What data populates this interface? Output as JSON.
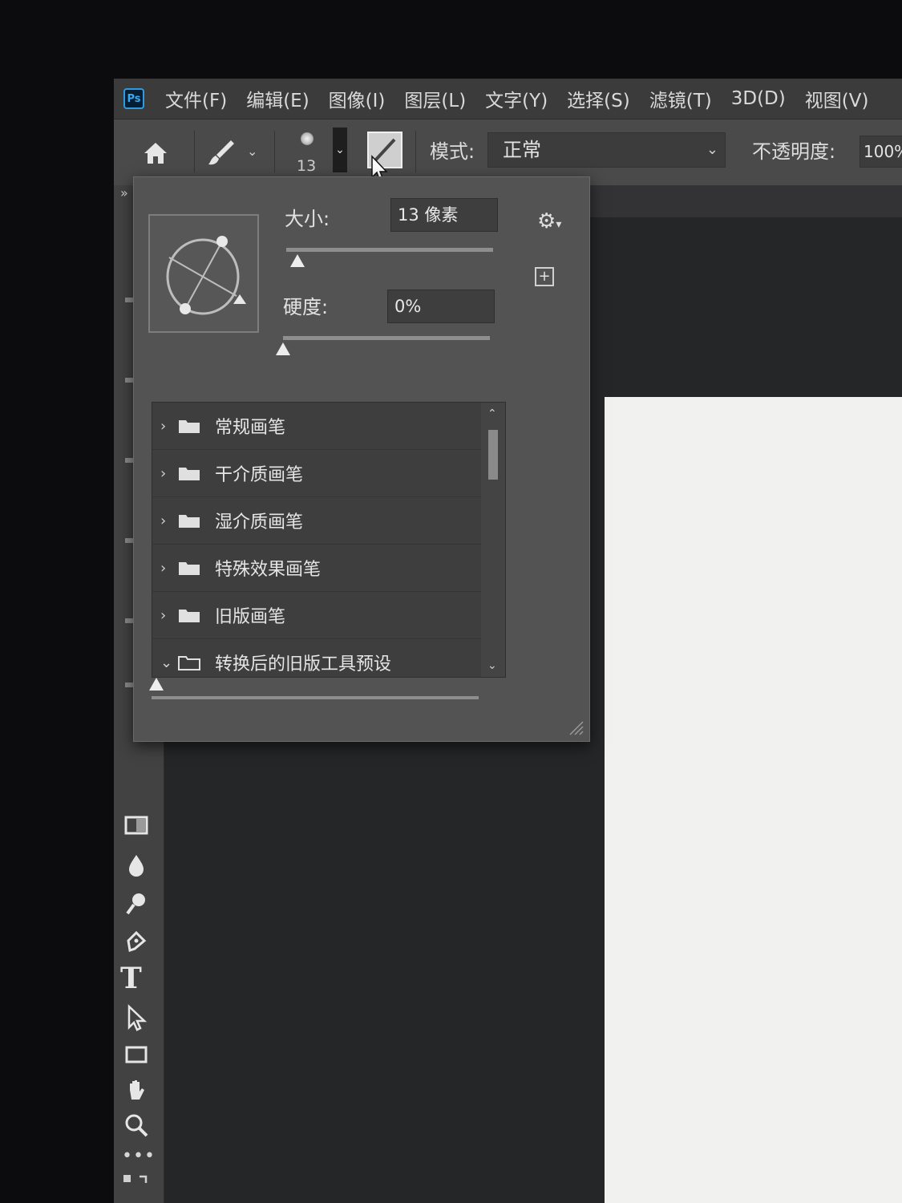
{
  "app": {
    "logo_text": "Ps"
  },
  "menu": {
    "items": [
      {
        "label": "文件(F)"
      },
      {
        "label": "编辑(E)"
      },
      {
        "label": "图像(I)"
      },
      {
        "label": "图层(L)"
      },
      {
        "label": "文字(Y)"
      },
      {
        "label": "选择(S)"
      },
      {
        "label": "滤镜(T)"
      },
      {
        "label": "3D(D)"
      },
      {
        "label": "视图(V)"
      }
    ]
  },
  "options_bar": {
    "brush_preset_size": "13",
    "mode_label": "模式:",
    "mode_value": "正常",
    "opacity_label": "不透明度:",
    "opacity_value": "100%"
  },
  "brush_panel": {
    "size_label": "大小:",
    "size_value": "13 像素",
    "size_slider_fraction": 0.03,
    "hardness_label": "硬度:",
    "hardness_value": "0%",
    "hardness_slider_fraction": 0.0,
    "preview_size_slider_fraction": 0.0,
    "groups": [
      {
        "name": "常规画笔",
        "expanded": false
      },
      {
        "name": "干介质画笔",
        "expanded": false
      },
      {
        "name": "湿介质画笔",
        "expanded": false
      },
      {
        "name": "特殊效果画笔",
        "expanded": false
      },
      {
        "name": "旧版画笔",
        "expanded": false
      },
      {
        "name": "转换后的旧版工具预设",
        "expanded": true
      }
    ]
  },
  "colors": {
    "menubar": "#3b3b3b",
    "optionsbar": "#4a4a4a",
    "panel": "#535353",
    "canvas": "#f1f1ef",
    "ps_blue": "#2f9bdf"
  }
}
